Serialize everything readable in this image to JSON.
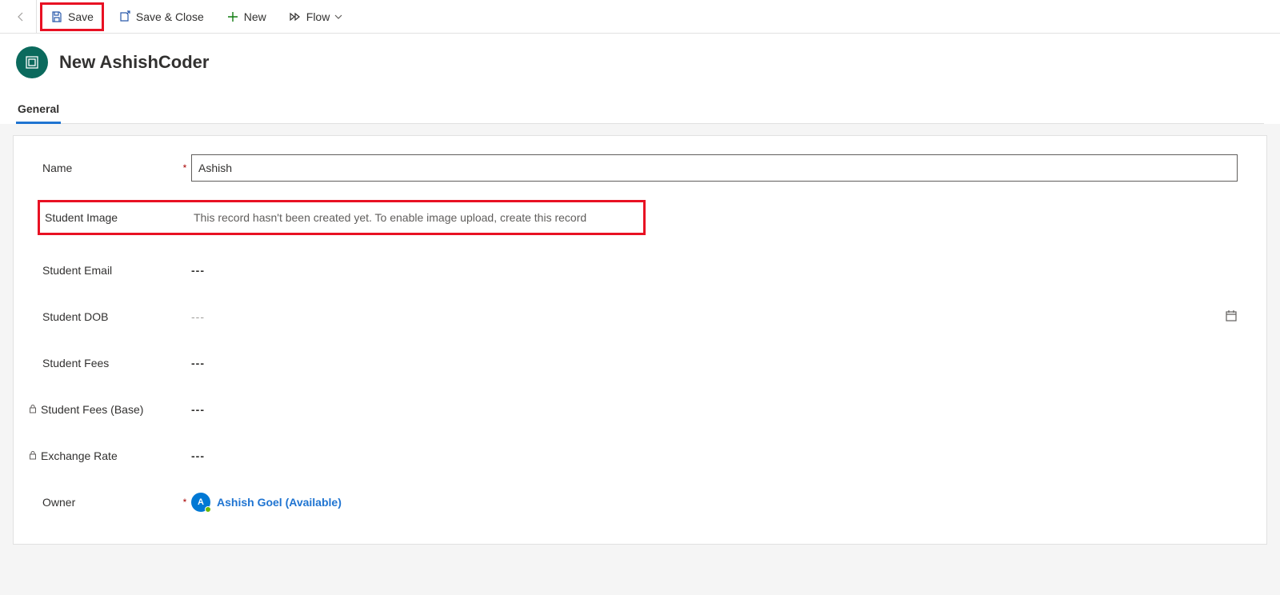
{
  "toolbar": {
    "save_label": "Save",
    "save_close_label": "Save & Close",
    "new_label": "New",
    "flow_label": "Flow"
  },
  "header": {
    "title": "New AshishCoder"
  },
  "tabs": {
    "general": "General"
  },
  "form": {
    "name_label": "Name",
    "name_value": "Ashish",
    "student_image_label": "Student Image",
    "student_image_msg": "This record hasn't been created yet. To enable image upload, create this record",
    "student_email_label": "Student Email",
    "student_email_value": "---",
    "student_dob_label": "Student DOB",
    "student_dob_value": "---",
    "student_fees_label": "Student Fees",
    "student_fees_value": "---",
    "student_fees_base_label": "Student Fees (Base)",
    "student_fees_base_value": "---",
    "exchange_rate_label": "Exchange Rate",
    "exchange_rate_value": "---",
    "owner_label": "Owner",
    "owner_initial": "A",
    "owner_value": "Ashish Goel (Available)"
  }
}
